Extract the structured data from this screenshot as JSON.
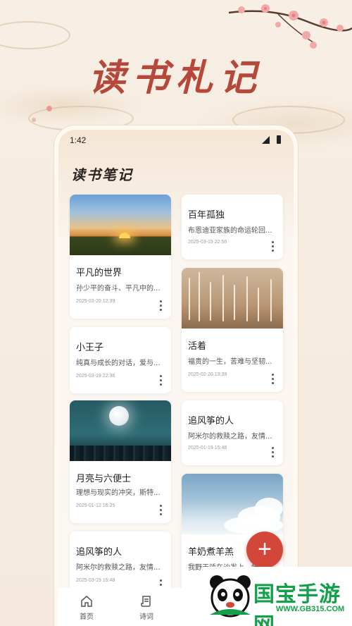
{
  "headline": "读书札记",
  "status": {
    "time": "1:42"
  },
  "page_title": "读书笔记",
  "left_cards": [
    {
      "title": "平凡的世界",
      "desc": "孙少平的奋斗、平凡中的...",
      "date": "2025-03-20 12:39"
    },
    {
      "title": "小王子",
      "desc": "纯真与成长的对话，爱与...",
      "date": "2025-03-19 22:36"
    },
    {
      "title": "月亮与六便士",
      "desc": "理想与现实的冲突，斯特...",
      "date": "2025-01-12 16:25"
    },
    {
      "title": "追风筝的人",
      "desc": "阿米尔的救赎之路，友情...",
      "date": "2025-03-19 15:48"
    }
  ],
  "right_cards": [
    {
      "title": "百年孤独",
      "desc": "布恩迪亚家族的命运轮回...",
      "date": "2025-03-19 22:56"
    },
    {
      "title": "活着",
      "desc": "福贵的一生，苦难与坚韧...",
      "date": "2025-02-20 13:39"
    },
    {
      "title": "追风筝的人",
      "desc": "阿米尔的救赎之路，友情...",
      "date": "2025-01-19 15:48"
    },
    {
      "title": "羊奶煮羊羔",
      "desc": "我野天骄在沙发上，帐...",
      "date": ""
    }
  ],
  "fab_label": "+",
  "nav": [
    {
      "label": "首页",
      "icon": "home-icon"
    },
    {
      "label": "诗词",
      "icon": "scroll-icon"
    }
  ],
  "watermark": {
    "text": "国宝手游网",
    "url_text": "WWW.GB315.COM"
  },
  "colors": {
    "accent": "#d2473a",
    "headline": "#b5483a",
    "logo_green": "#14a04a"
  }
}
